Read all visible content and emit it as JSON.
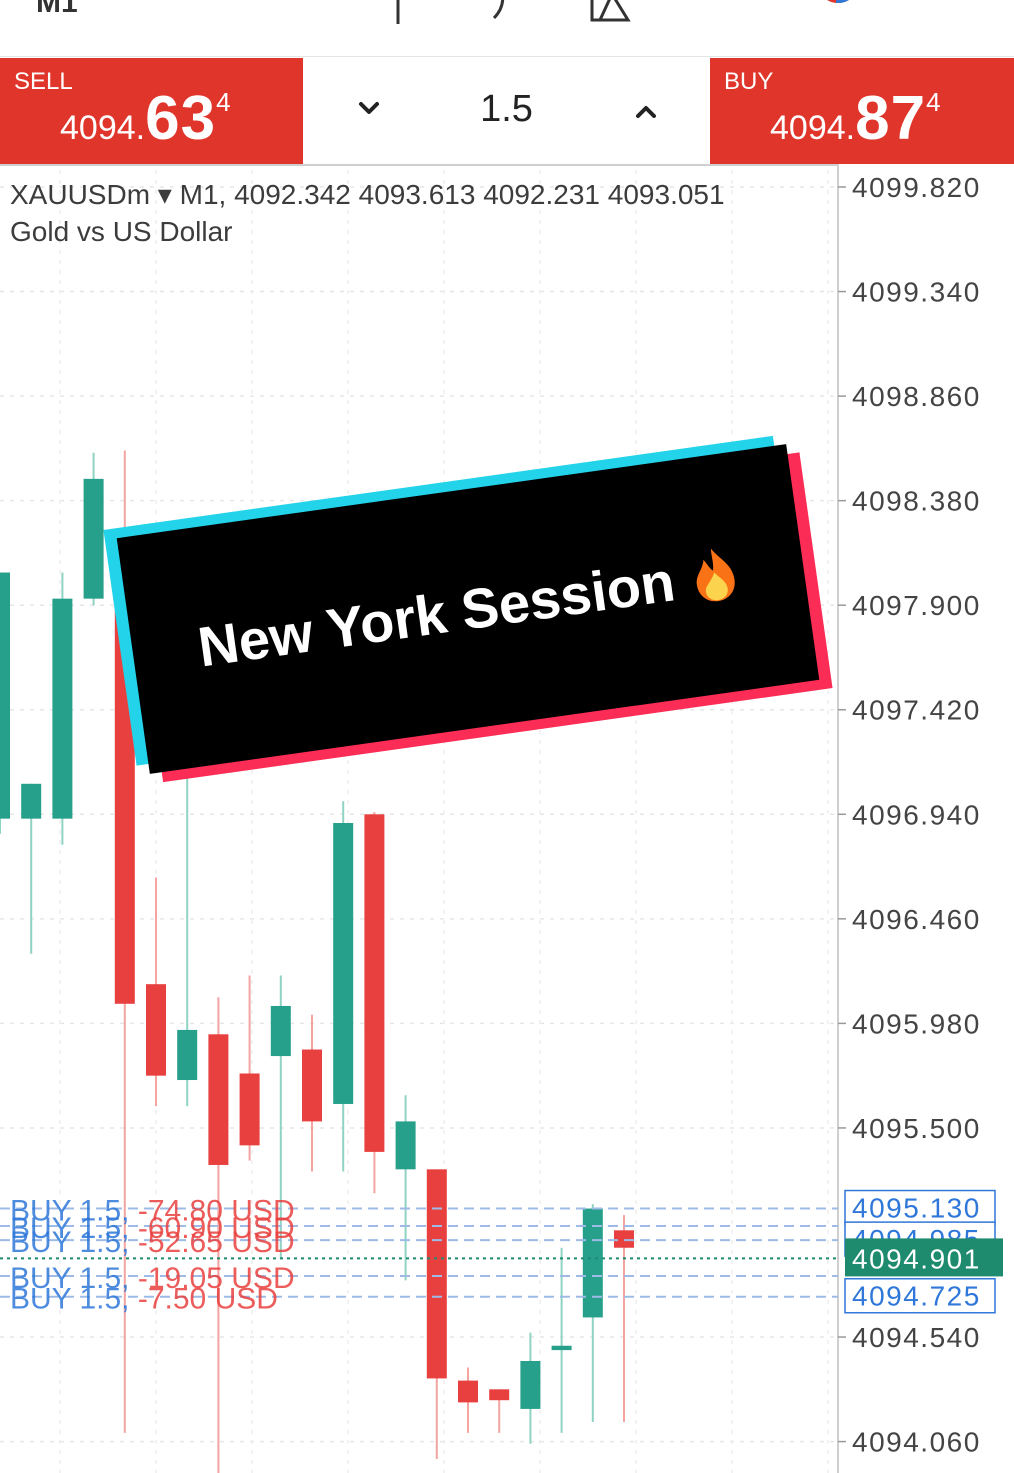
{
  "topbar": {
    "timeframe": "M1"
  },
  "sell": {
    "label": "SELL",
    "price_main": "4094.",
    "price_big": "63",
    "price_sup": "4"
  },
  "buy": {
    "label": "BUY",
    "price_main": "4094.",
    "price_big": "87",
    "price_sup": "4"
  },
  "volume": "1.5",
  "chart": {
    "symbol_line": "XAUUSDm ▾ M1, 4092.342 4093.613 4092.231 4093.051",
    "description": "Gold vs US Dollar",
    "colors": {
      "bull": "#26a08a",
      "bear": "#e8403f",
      "order": "#2f77d9",
      "current": "#1e8a6e"
    }
  },
  "banner": {
    "text": "New York Session"
  },
  "chart_data": {
    "type": "candlestick",
    "ylim": [
      4093.9,
      4100.0
    ],
    "y_ticks": [
      "4099.820",
      "4099.340",
      "4098.860",
      "4098.380",
      "4097.900",
      "4097.420",
      "4096.940",
      "4096.460",
      "4095.980",
      "4095.500",
      "4094.540",
      "4094.060"
    ],
    "candles": [
      {
        "o": 4096.92,
        "h": 4098.0,
        "l": 4096.85,
        "c": 4098.05
      },
      {
        "o": 4096.92,
        "h": 4097.05,
        "l": 4096.3,
        "c": 4097.08
      },
      {
        "o": 4096.92,
        "h": 4098.05,
        "l": 4096.8,
        "c": 4097.93
      },
      {
        "o": 4097.93,
        "h": 4098.6,
        "l": 4097.9,
        "c": 4098.48
      },
      {
        "o": 4098.24,
        "h": 4098.61,
        "l": 4094.1,
        "c": 4096.07
      },
      {
        "o": 4096.16,
        "h": 4096.65,
        "l": 4095.6,
        "c": 4095.74
      },
      {
        "o": 4095.72,
        "h": 4097.3,
        "l": 4095.6,
        "c": 4095.95
      },
      {
        "o": 4095.93,
        "h": 4096.1,
        "l": 4093.9,
        "c": 4095.33
      },
      {
        "o": 4095.75,
        "h": 4096.2,
        "l": 4095.35,
        "c": 4095.42
      },
      {
        "o": 4095.83,
        "h": 4096.2,
        "l": 4094.9,
        "c": 4096.06
      },
      {
        "o": 4095.86,
        "h": 4096.02,
        "l": 4095.3,
        "c": 4095.53
      },
      {
        "o": 4095.61,
        "h": 4097.0,
        "l": 4095.3,
        "c": 4096.9
      },
      {
        "o": 4096.94,
        "h": 4096.95,
        "l": 4095.2,
        "c": 4095.39
      },
      {
        "o": 4095.31,
        "h": 4095.65,
        "l": 4094.8,
        "c": 4095.53
      },
      {
        "o": 4095.31,
        "h": 4095.31,
        "l": 4093.98,
        "c": 4094.35
      },
      {
        "o": 4094.34,
        "h": 4094.4,
        "l": 4094.1,
        "c": 4094.24
      },
      {
        "o": 4094.3,
        "h": 4094.28,
        "l": 4094.1,
        "c": 4094.25
      },
      {
        "o": 4094.21,
        "h": 4094.56,
        "l": 4094.05,
        "c": 4094.43
      },
      {
        "o": 4094.48,
        "h": 4094.95,
        "l": 4094.1,
        "c": 4094.5
      },
      {
        "o": 4094.63,
        "h": 4095.15,
        "l": 4094.15,
        "c": 4095.13
      },
      {
        "o": 4095.03,
        "h": 4095.1,
        "l": 4094.15,
        "c": 4094.95
      }
    ],
    "orders": [
      {
        "label": "BUY 1.5, -74.80 USD",
        "price": 4095.13,
        "tag": "4095.130"
      },
      {
        "label": "BUY 1.5, -60.90 USD",
        "price": 4095.05,
        "tag": ""
      },
      {
        "label": "BUY 1.5, -52.65 USD",
        "price": 4094.985,
        "tag": "4094.985"
      },
      {
        "label": "BUY 1.5, -19.05 USD",
        "price": 4094.82,
        "tag": ""
      },
      {
        "label": "BUY 1.5, -7.50 USD",
        "price": 4094.725,
        "tag": "4094.725"
      }
    ],
    "current_price": "4094.901"
  }
}
